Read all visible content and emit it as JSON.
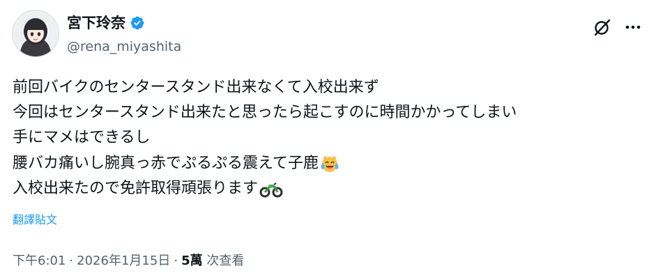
{
  "author": {
    "display_name": "宮下玲奈",
    "handle": "@rena_miyashita",
    "verified_color": "#1d9bf0",
    "avatar_icon": "avatar-illustration"
  },
  "actions": {
    "grok_icon": "grok-icon",
    "more_icon": "more-icon"
  },
  "tweet": {
    "lines": [
      "前回バイクのセンタースタンド出来なくて入校出来ず",
      "今回はセンタースタンド出来たと思ったら起こすのに時間かかってしまい",
      "手にマメはできるし",
      "腰バカ痛いし腕真っ赤でぷるぷる震えて子鹿",
      "入校出来たので免許取得頑張ります"
    ],
    "emoji_line4": "laughing-cat-emoji",
    "emoji_line5": "motorcycle-emoji"
  },
  "translate_label": "翻譯貼文",
  "meta": {
    "time": "下午6:01",
    "date": "2026年1月15日",
    "separator": "·",
    "views_count": "5萬",
    "views_label": "次查看"
  }
}
